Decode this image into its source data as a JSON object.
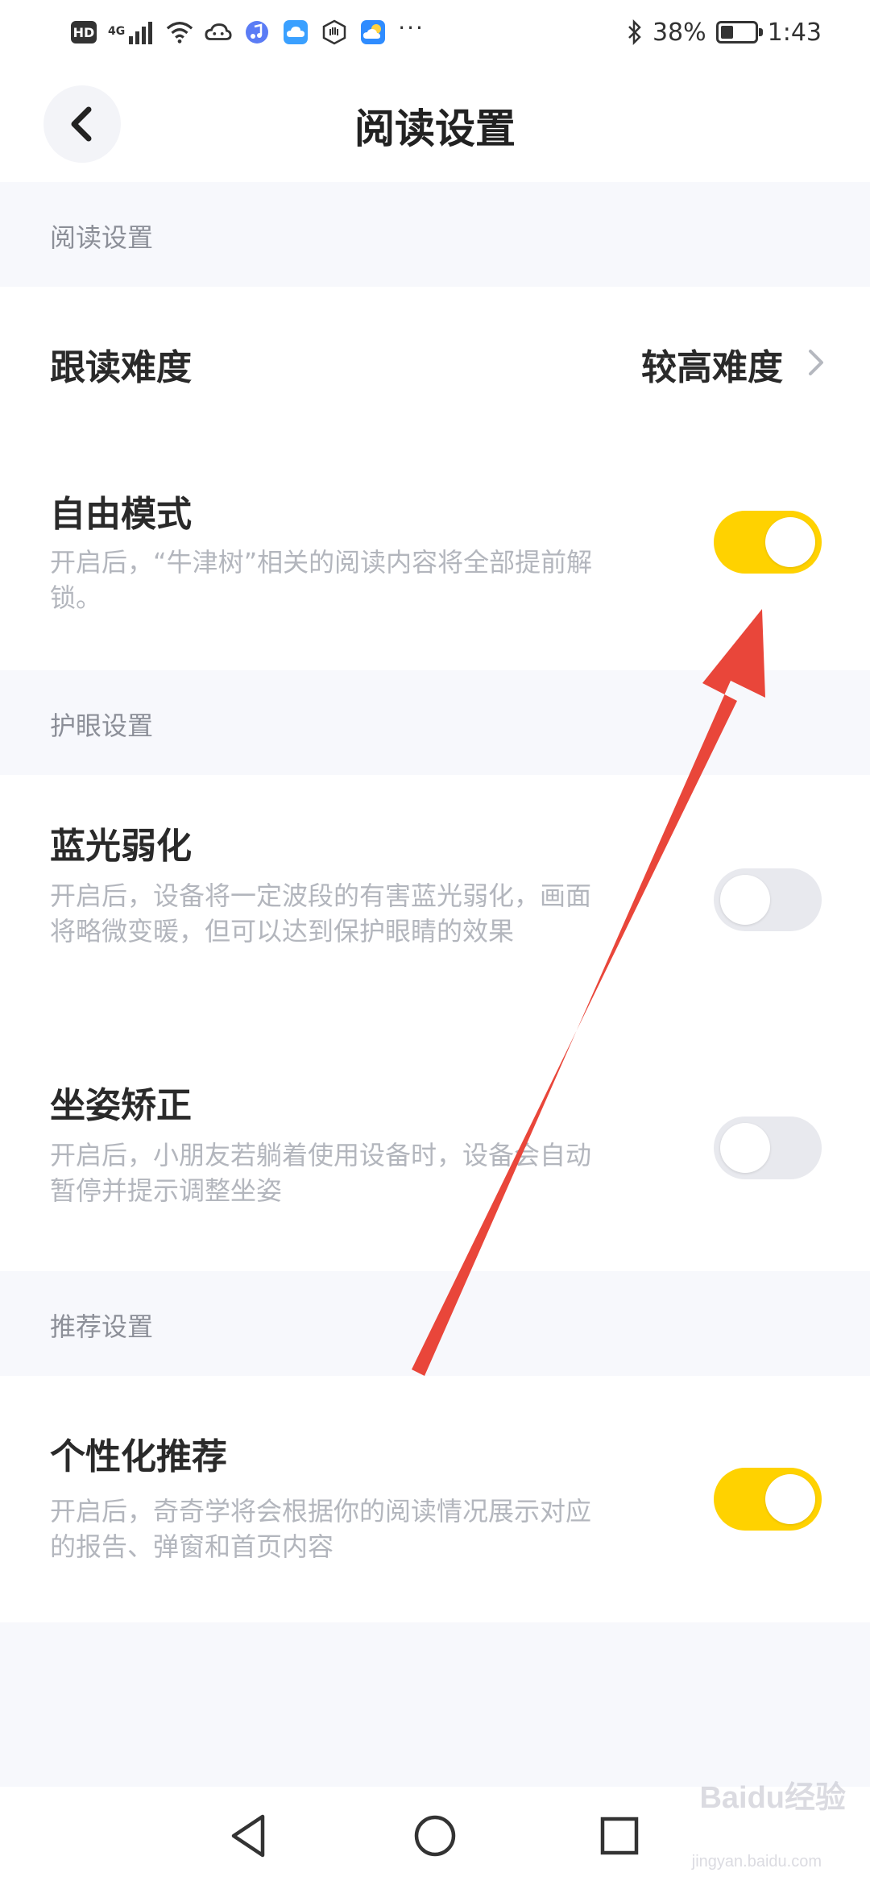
{
  "status_bar": {
    "hd_badge": "HD",
    "network": "4G",
    "dots": "···",
    "battery_percent": "38%",
    "time": "1:43",
    "battery_level": 0.38,
    "icons": [
      "hd-icon",
      "signal-icon",
      "wifi-icon",
      "cloud-icon",
      "music-icon",
      "cloud-drive-icon",
      "hand-icon",
      "weather-icon",
      "bluetooth-icon",
      "battery-icon"
    ]
  },
  "header": {
    "title": "阅读设置",
    "back_icon": "chevron-left-icon"
  },
  "sections": {
    "reading": {
      "label": "阅读设置",
      "difficulty": {
        "title": "跟读难度",
        "value": "较高难度"
      },
      "free_mode": {
        "title": "自由模式",
        "desc": "开启后，“牛津树”相关的阅读内容将全部提前解锁。",
        "enabled": true
      }
    },
    "eye_care": {
      "label": "护眼设置",
      "blue_light": {
        "title": "蓝光弱化",
        "desc": "开启后，设备将一定波段的有害蓝光弱化，画面将略微变暖，但可以达到保护眼睛的效果",
        "enabled": false
      },
      "posture": {
        "title": "坐姿矫正",
        "desc": "开启后，小朋友若躺着使用设备时，设备会自动暂停并提示调整坐姿",
        "enabled": false
      }
    },
    "recommend": {
      "label": "推荐设置",
      "personalized": {
        "title": "个性化推荐",
        "desc": "开启后，奇奇学将会根据你的阅读情况展示对应的报告、弹窗和首页内容",
        "enabled": true
      }
    }
  },
  "colors": {
    "toggle_on": "#ffd200",
    "toggle_off": "#e8e9ee",
    "arrow": "#e9463a",
    "background": "#f7f8fc"
  },
  "watermark": {
    "text": "Baidu经验",
    "sub": "jingyan.baidu.com"
  }
}
